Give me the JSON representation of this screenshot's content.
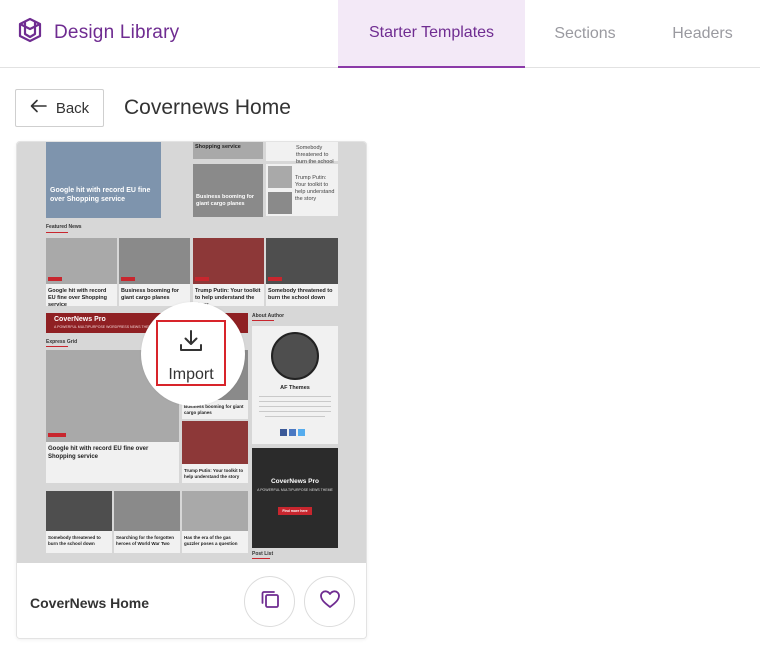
{
  "header": {
    "brand": "Design Library",
    "tabs": [
      {
        "label": "Starter Templates",
        "active": true
      },
      {
        "label": "Sections",
        "active": false
      },
      {
        "label": "Headers",
        "active": false
      }
    ]
  },
  "nav": {
    "back_label": "Back",
    "page_title": "Covernews Home"
  },
  "card": {
    "name": "CoverNews Home",
    "import_label": "Import",
    "preview": {
      "hero_title": "Google hit with record EU fine over Shopping service",
      "side_items": [
        "Shopping service",
        "Business booming for giant cargo planes",
        "Somebody threatened to burn the school down",
        "Trump Putin: Your toolkit to help understand the story"
      ],
      "featured_label": "Featured News",
      "featured_items": [
        "Google hit with record EU fine over Shopping service",
        "Business booming for giant cargo planes",
        "Trump Putin: Your toolkit to help understand the story",
        "Somebody threatened to burn the school down"
      ],
      "banner_title": "CoverNews Pro",
      "banner_sub": "A POWERFUL MULTIPURPOSE WORDPRESS NEWS THEME",
      "express_label": "Express Grid",
      "about_label": "About Author",
      "author_name": "AF Themes",
      "grid_title": "Google hit with record EU fine over Shopping service",
      "grid_right_items": [
        "Business booming for giant cargo planes",
        "Trump Putin: Your toolkit to help understand the story"
      ],
      "grid_bottom_items": [
        "Somebody threatened to burn the school down",
        "Searching for the forgotten heroes of World War Two",
        "Has the era of the gas guzzler poses a question"
      ],
      "ad_title": "CoverNews Pro",
      "ad_sub": "A POWERFUL MULTIPURPOSE NEWS THEME",
      "ad_button": "Find more here",
      "post_list_label": "Post List"
    }
  },
  "colors": {
    "brand": "#6f2c91",
    "active_tab_bg": "#f3e9f7",
    "import_outline": "#d8242a",
    "preview_bg": "#d7d7d7"
  },
  "icons": [
    "logo-icon",
    "arrow-left-icon",
    "download-icon",
    "copy-icon",
    "heart-icon"
  ]
}
